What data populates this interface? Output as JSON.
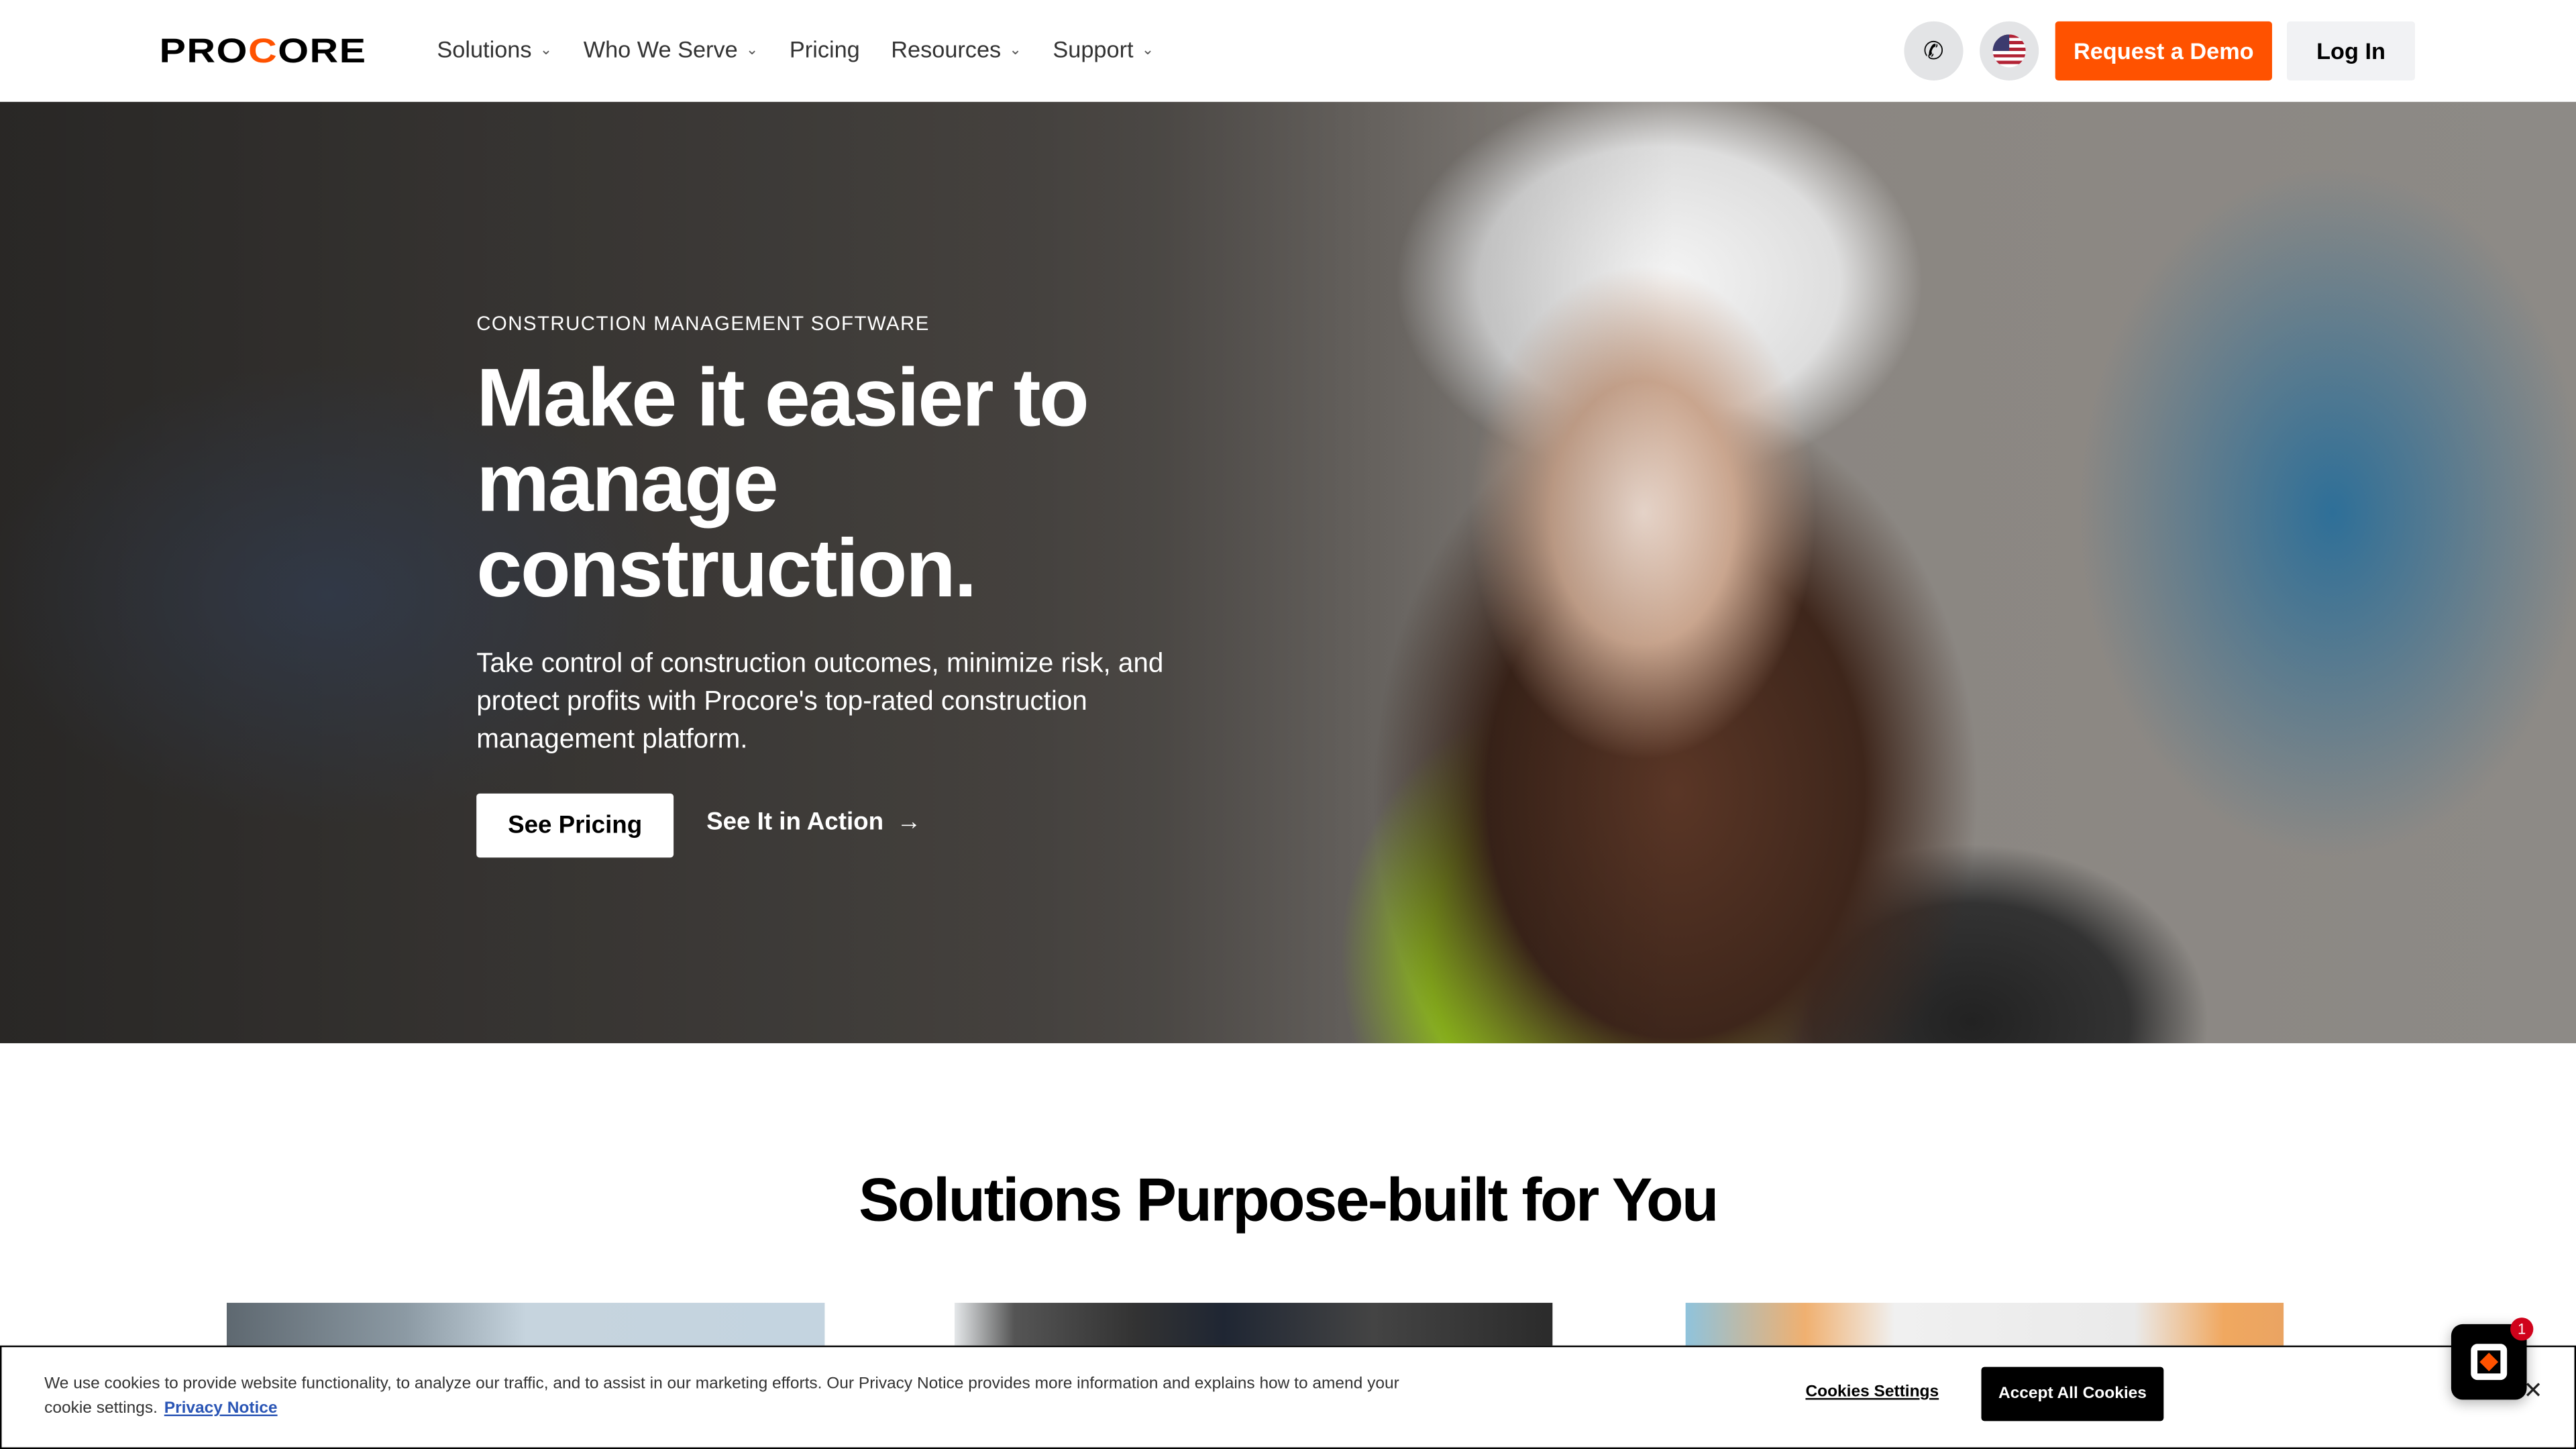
{
  "header": {
    "logo_pre": "PRO",
    "logo_o": "C",
    "logo_post": "ORE",
    "logo_text": "PROCORE",
    "nav": [
      {
        "label": "Solutions",
        "dropdown": true
      },
      {
        "label": "Who We Serve",
        "dropdown": true
      },
      {
        "label": "Pricing",
        "dropdown": false
      },
      {
        "label": "Resources",
        "dropdown": true
      },
      {
        "label": "Support",
        "dropdown": true
      }
    ],
    "phone_icon": "phone-icon",
    "language_icon": "us-flag-icon",
    "request_demo": "Request a Demo",
    "login": "Log In"
  },
  "hero": {
    "eyebrow": "CONSTRUCTION MANAGEMENT SOFTWARE",
    "title": "Make it easier to manage construction.",
    "subtitle": "Take control of construction outcomes, minimize risk, and protect profits with Procore's top-rated construction management platform.",
    "primary_cta": "See Pricing",
    "secondary_cta": "See It in Action",
    "arrow": "→"
  },
  "solutions": {
    "title": "Solutions Purpose-built for You"
  },
  "cookie": {
    "text": "We use cookies to provide website functionality, to analyze our traffic, and to assist in our marketing efforts. Our Privacy Notice provides more information and explains how to amend your cookie settings.",
    "privacy_link": "Privacy Notice",
    "settings": "Cookies Settings",
    "accept": "Accept All Cookies",
    "close": "✕"
  },
  "chat": {
    "badge": "1"
  },
  "colors": {
    "brand": "#ff5200"
  }
}
